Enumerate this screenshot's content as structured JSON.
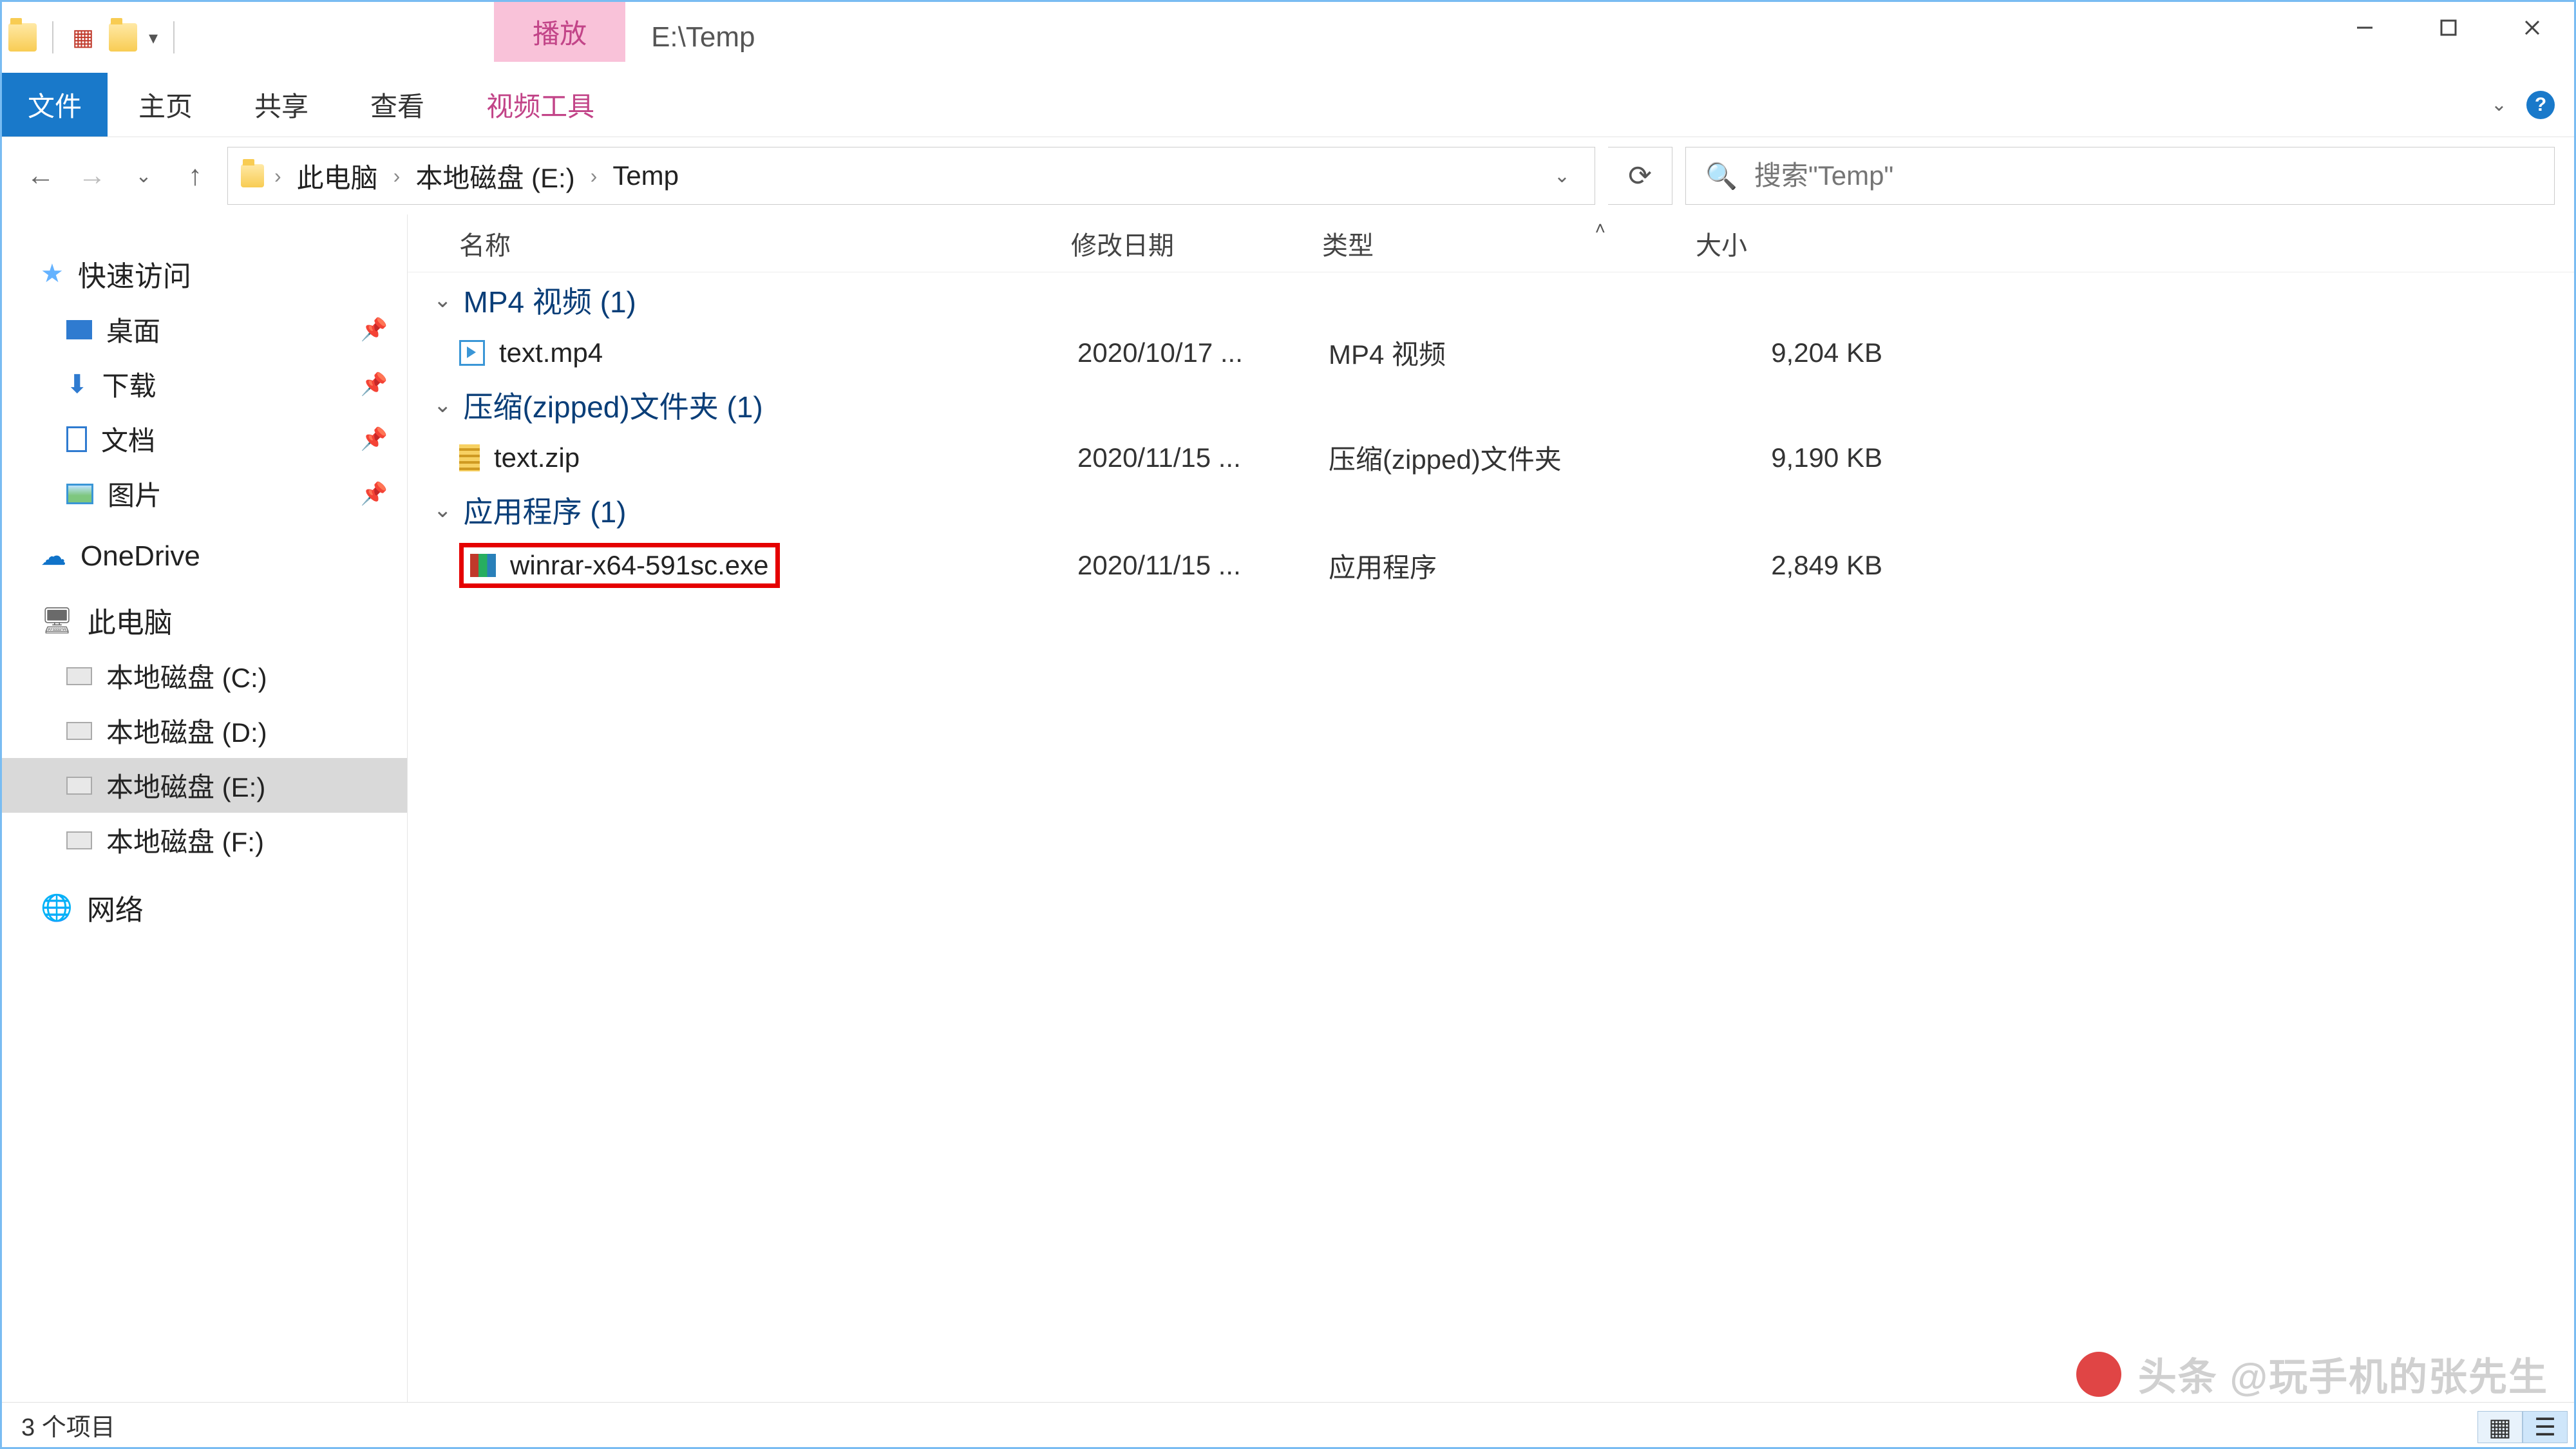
{
  "title": {
    "context_tab": "播放",
    "path": "E:\\Temp"
  },
  "ribbon": {
    "file": "文件",
    "home": "主页",
    "share": "共享",
    "view": "查看",
    "tool": "视频工具"
  },
  "breadcrumb": {
    "this_pc": "此电脑",
    "drive": "本地磁盘 (E:)",
    "folder": "Temp"
  },
  "search": {
    "placeholder": "搜索\"Temp\""
  },
  "nav": {
    "quick_access": "快速访问",
    "desktop": "桌面",
    "downloads": "下载",
    "documents": "文档",
    "pictures": "图片",
    "onedrive": "OneDrive",
    "this_pc": "此电脑",
    "drive_c": "本地磁盘 (C:)",
    "drive_d": "本地磁盘 (D:)",
    "drive_e": "本地磁盘 (E:)",
    "drive_f": "本地磁盘 (F:)",
    "network": "网络"
  },
  "columns": {
    "name": "名称",
    "date": "修改日期",
    "type": "类型",
    "size": "大小"
  },
  "groups": [
    {
      "header": "MP4 视频 (1)",
      "rows": [
        {
          "name": "text.mp4",
          "date": "2020/10/17 ...",
          "type": "MP4 视频",
          "size": "9,204 KB",
          "icon": "video"
        }
      ]
    },
    {
      "header": "压缩(zipped)文件夹 (1)",
      "rows": [
        {
          "name": "text.zip",
          "date": "2020/11/15 ...",
          "type": "压缩(zipped)文件夹",
          "size": "9,190 KB",
          "icon": "zip"
        }
      ]
    },
    {
      "header": "应用程序 (1)",
      "rows": [
        {
          "name": "winrar-x64-591sc.exe",
          "date": "2020/11/15 ...",
          "type": "应用程序",
          "size": "2,849 KB",
          "icon": "exe",
          "highlight": true
        }
      ]
    }
  ],
  "status": {
    "items": "3 个项目"
  },
  "watermark": "头条 @玩手机的张先生"
}
